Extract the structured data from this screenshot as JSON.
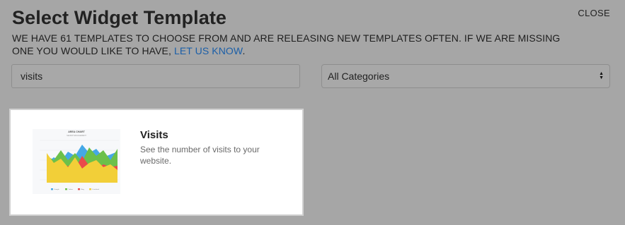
{
  "dialog": {
    "title": "Select Widget Template",
    "close_label": "CLOSE",
    "intro_text": "WE HAVE 61 TEMPLATES TO CHOOSE FROM AND ARE RELEASING NEW TEMPLATES OFTEN. IF WE ARE MISSING ONE YOU WOULD LIKE TO HAVE, ",
    "intro_link": "LET US KNOW",
    "intro_end": "."
  },
  "search": {
    "value": "visits"
  },
  "category_select": {
    "selected": "All Categories",
    "icon": "select-arrows-icon"
  },
  "templates": [
    {
      "name": "Visits",
      "description": "See the number of visits to your website.",
      "thumbnail": {
        "title": "AREA CHART",
        "subtitle": "SEARCH ENGAGEMENT",
        "legend": [
          "Google",
          "Yahoo",
          "Bing",
          "Duckduck"
        ],
        "colors": [
          "#f2cf38",
          "#6cc04a",
          "#e94b4b",
          "#45a8e6"
        ]
      }
    }
  ]
}
